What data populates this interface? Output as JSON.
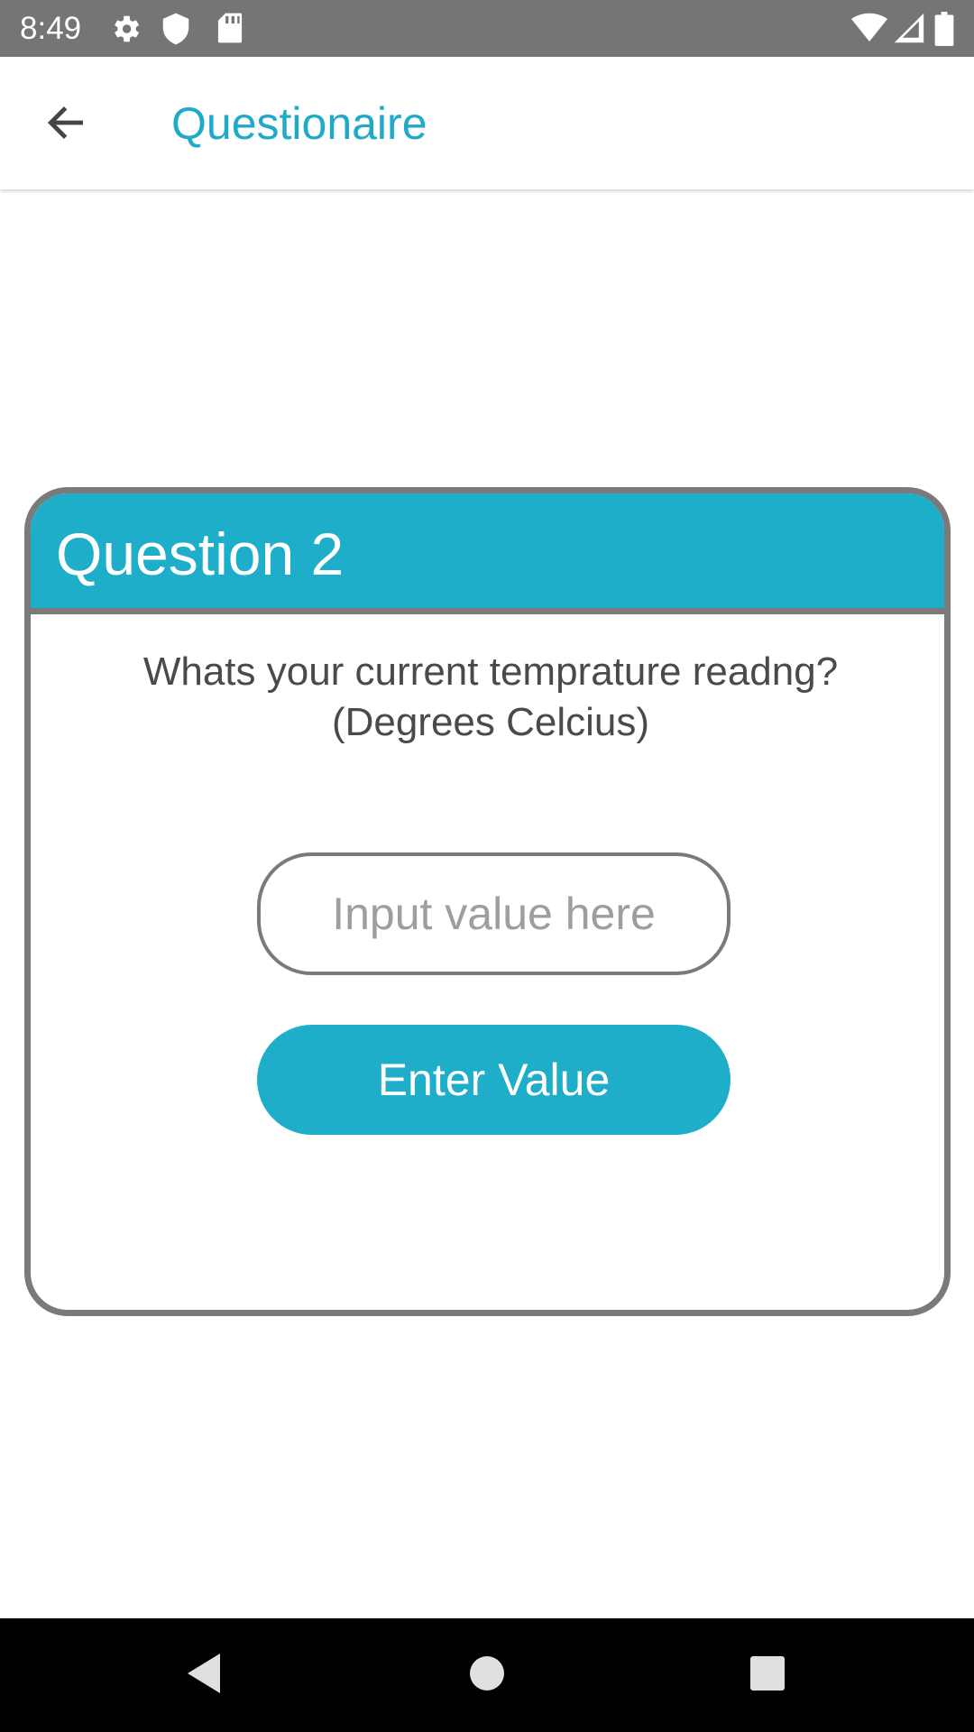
{
  "status_bar": {
    "time": "8:49",
    "left_icons": [
      "gear-icon",
      "shield-icon",
      "sd-card-icon"
    ],
    "right_icons": [
      "wifi-icon",
      "cell-signal-icon",
      "battery-icon"
    ],
    "background": "#757575"
  },
  "app_bar": {
    "title": "Questionaire",
    "back_icon": "arrow-left-icon",
    "title_color": "#1eaac8"
  },
  "question_card": {
    "title": "Question 2",
    "question": "Whats your current temprature readng? (Degrees Celcius)",
    "input": {
      "value": "",
      "placeholder": "Input value here"
    },
    "button_label": "Enter Value",
    "accent_color": "#1eaec9",
    "border_color": "#7a7a7a"
  },
  "nav_bar": {
    "buttons": [
      "back-triangle-icon",
      "home-circle-icon",
      "recents-square-icon"
    ]
  }
}
